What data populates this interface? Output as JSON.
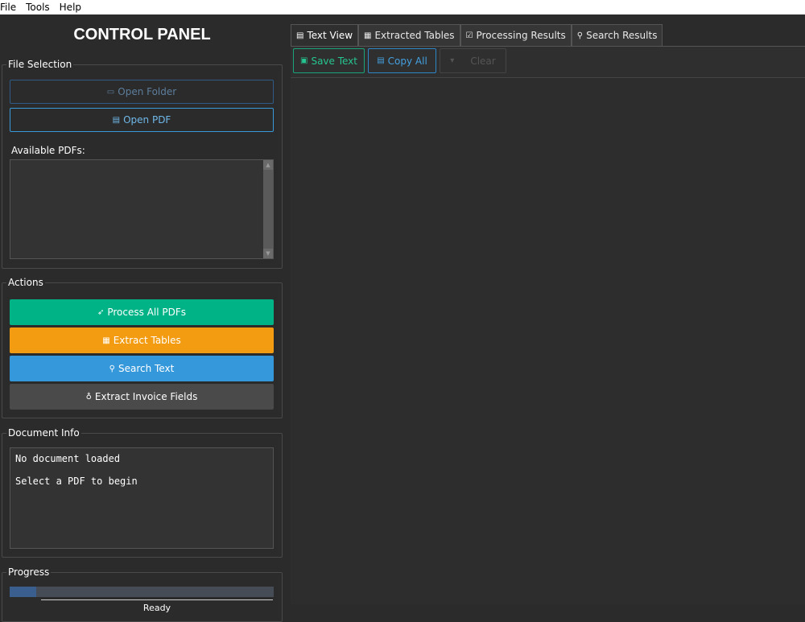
{
  "menubar": {
    "file": "File",
    "tools": "Tools",
    "help": "Help"
  },
  "control_panel": {
    "title": "CONTROL PANEL",
    "file_selection": {
      "legend": "File Selection",
      "open_folder_icon": "folder-icon",
      "open_folder": "Open Folder",
      "open_pdf_icon": "document-icon",
      "open_pdf": "Open PDF",
      "available_label": "Available PDFs:",
      "pdfs": []
    },
    "actions": {
      "legend": "Actions",
      "process_all": "Process All PDFs",
      "extract_tables": "Extract Tables",
      "search_text": "Search Text",
      "extract_invoice": "Extract Invoice Fields",
      "colors": {
        "process": "#00b386",
        "tables": "#f39c12",
        "search": "#3598db",
        "invoice": "#4a4a4a"
      }
    },
    "document_info": {
      "legend": "Document Info",
      "line1": "No document loaded",
      "line2": "Select a PDF to begin"
    },
    "progress": {
      "legend": "Progress",
      "value_percent": 10,
      "status": "Ready"
    }
  },
  "tabs": [
    {
      "label": "Text View",
      "icon": "document-icon",
      "active": true
    },
    {
      "label": "Extracted Tables",
      "icon": "table-icon",
      "active": false
    },
    {
      "label": "Processing Results",
      "icon": "checkbox-icon",
      "active": false
    },
    {
      "label": "Search Results",
      "icon": "search-icon",
      "active": false
    }
  ],
  "text_toolbar": {
    "save": "Save Text",
    "copy": "Copy All",
    "clear": "Clear"
  }
}
